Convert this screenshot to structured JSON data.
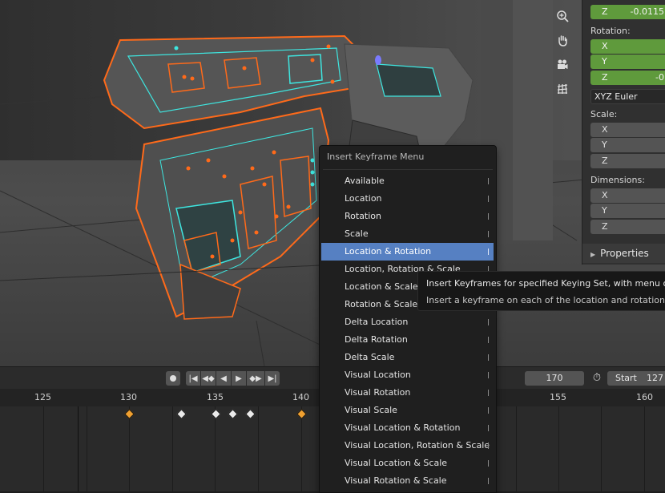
{
  "viewport": {
    "tools": [
      {
        "icon": "zoom-icon",
        "glyph": "⊕"
      },
      {
        "icon": "hand-pan-icon",
        "glyph": "✋"
      },
      {
        "icon": "camera-icon",
        "glyph": "🎥"
      },
      {
        "icon": "grid-icon",
        "glyph": "▦"
      }
    ]
  },
  "npanel": {
    "location_z_label": "Z",
    "location_z_value": "-0.0115",
    "rotation_label": "Rotation:",
    "rotation_x": "X",
    "rotation_y": "Y",
    "rotation_z": "Z",
    "rotation_z_value": "-0",
    "rotation_mode": "XYZ Euler",
    "scale_label": "Scale:",
    "scale_x": "X",
    "scale_y": "Y",
    "scale_z": "Z",
    "dimensions_label": "Dimensions:",
    "dim_x": "X",
    "dim_y": "Y",
    "dim_z": "Z",
    "properties_header": "Properties",
    "accent_green": "#5f9a3c"
  },
  "timeline": {
    "current_frame": "170",
    "start_label": "Start",
    "start_value": "127",
    "ticks": [
      "125",
      "130",
      "135",
      "140",
      "155",
      "160"
    ]
  },
  "menu": {
    "title": "Insert Keyframe Menu",
    "highlight_color": "#5680c2",
    "items": [
      "Available",
      "Location",
      "Rotation",
      "Scale",
      "Location & Rotation",
      "Location, Rotation & Scale",
      "Location & Scale",
      "Rotation & Scale",
      "Delta Location",
      "Delta Rotation",
      "Delta Scale",
      "Visual Location",
      "Visual Rotation",
      "Visual Scale",
      "Visual Location & Rotation",
      "Visual Location, Rotation & Scale",
      "Visual Location & Scale",
      "Visual Rotation & Scale"
    ]
  },
  "tooltip": {
    "line1": "Insert Keyframes for specified Keying Set, with menu of avai",
    "line2": "Insert a keyframe on each of the location and rotation chann"
  }
}
